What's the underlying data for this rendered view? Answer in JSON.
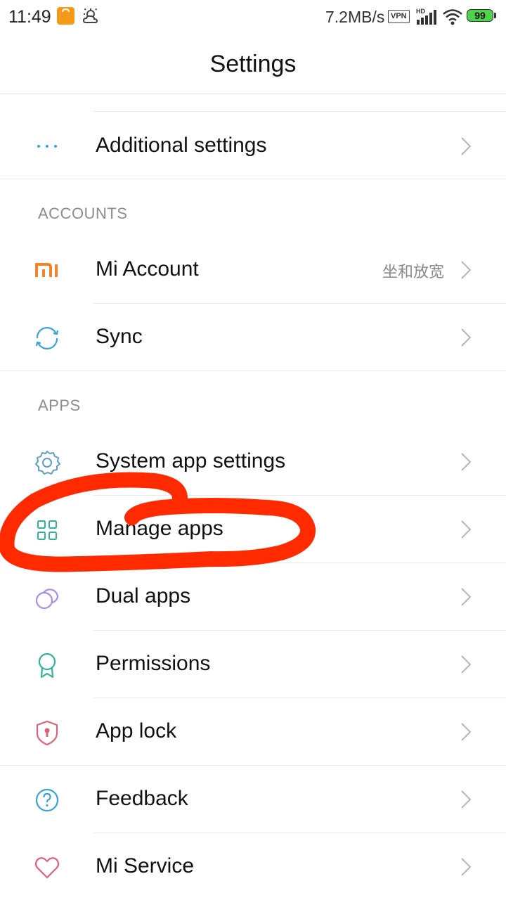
{
  "status_bar": {
    "time": "11:49",
    "network_speed": "7.2MB/s",
    "vpn_label": "VPN",
    "battery_level": "99",
    "icons": [
      "shopping-bag-icon",
      "weather-icon",
      "hd-signal-icon",
      "wifi-icon",
      "battery-icon"
    ]
  },
  "header": {
    "title": "Settings"
  },
  "rows": {
    "additional_settings": {
      "label": "Additional settings",
      "icon": "more-dots-icon"
    },
    "mi_account": {
      "label": "Mi Account",
      "value": "坐和放宽",
      "icon": "mi-logo-icon"
    },
    "sync": {
      "label": "Sync",
      "icon": "sync-icon"
    },
    "system_app_settings": {
      "label": "System app settings",
      "icon": "gear-icon"
    },
    "manage_apps": {
      "label": "Manage apps",
      "icon": "grid-apps-icon"
    },
    "dual_apps": {
      "label": "Dual apps",
      "icon": "dual-circles-icon"
    },
    "permissions": {
      "label": "Permissions",
      "icon": "ribbon-badge-icon"
    },
    "app_lock": {
      "label": "App lock",
      "icon": "shield-lock-icon"
    },
    "feedback": {
      "label": "Feedback",
      "icon": "help-circle-icon"
    },
    "mi_service": {
      "label": "Mi Service",
      "icon": "heart-icon"
    }
  },
  "sections": {
    "accounts": "ACCOUNTS",
    "apps": "APPS"
  },
  "colors": {
    "mi_orange": "#f0852d",
    "accent_blue": "#3aa3d8",
    "accent_teal": "#2fb39a",
    "accent_purple": "#a98de0",
    "accent_pink": "#e0607a",
    "annotation_red": "#ff2a00"
  }
}
